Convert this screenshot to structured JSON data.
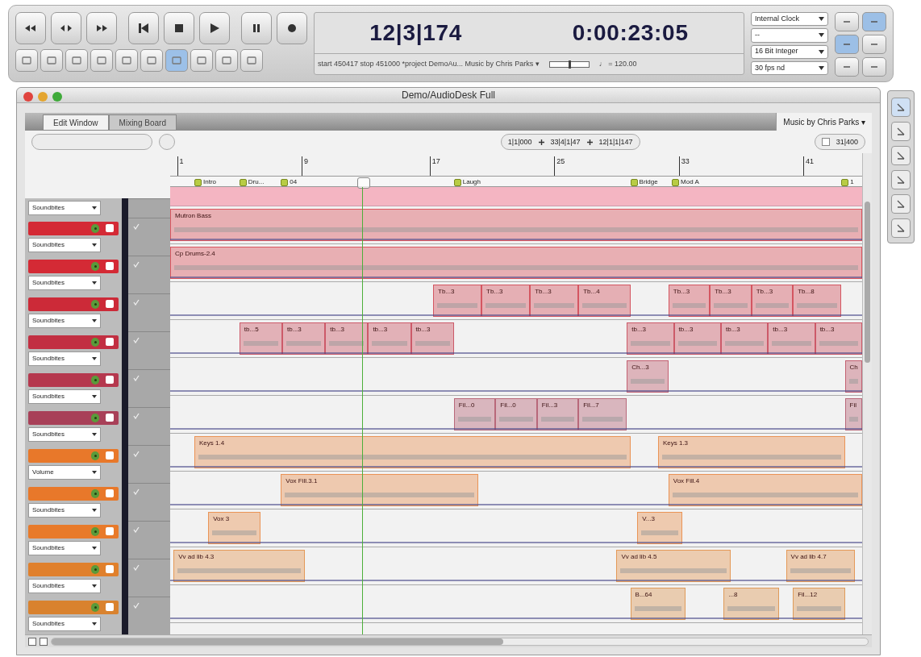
{
  "transport": {
    "counter_bars": "12|3|174",
    "counter_time": "0:00:23:05",
    "info": "start 450417 stop 451000 *project DemoAu... Music by Chris Parks ▾",
    "tempo": "♩ = 120.00",
    "tempo_slider": {
      "level": 0.5
    },
    "dropdowns": [
      "Internal Clock",
      "--",
      "16 Bit Integer",
      "30 fps nd"
    ]
  },
  "window": {
    "title": "Demo/AudioDesk Full"
  },
  "tabs": [
    {
      "label": "Edit Window",
      "selected": true
    },
    {
      "label": "Mixing Board",
      "selected": false
    }
  ],
  "chunk_menu": "Music by Chris Parks ▾",
  "toolbar": {
    "start": "1|1|000",
    "end": "33|4|1|47",
    "duration": "12|1|1|147",
    "zoom": "31|400",
    "checked": false
  },
  "ruler": [
    "1",
    "9",
    "17",
    "25",
    "33",
    "41"
  ],
  "markers": [
    "Intro",
    "Dru...",
    "04",
    "Laugh",
    "Bridge",
    "Mod A",
    "1"
  ],
  "top_automation": "Soundbites",
  "tracks": [
    {
      "color": "#d42a35",
      "automation": "Soundbites",
      "clips": [
        {
          "label": "Mutron Bass"
        }
      ]
    },
    {
      "color": "#d42a35",
      "automation": "Soundbites",
      "clips": [
        {
          "label": "Cp Drums-2.4"
        }
      ]
    },
    {
      "color": "#cc2a38",
      "automation": "Soundbites",
      "clips": [
        {
          "label": "Tb...3"
        },
        {
          "label": "Tb...3"
        },
        {
          "label": "Tb...3"
        },
        {
          "label": "Tb...4"
        },
        {
          "label": "Tb...3"
        },
        {
          "label": "Tb...3"
        },
        {
          "label": "Tb...3"
        },
        {
          "label": "Tb...8"
        }
      ]
    },
    {
      "color": "#c22f42",
      "automation": "Soundbites",
      "clips": [
        {
          "label": "tb...5"
        },
        {
          "label": "tb...3"
        },
        {
          "label": "tb...3"
        },
        {
          "label": "tb...3"
        },
        {
          "label": "tb...3"
        },
        {
          "label": "tb...3"
        },
        {
          "label": "tb...3"
        },
        {
          "label": "tb...3"
        },
        {
          "label": "tb...3"
        },
        {
          "label": "tb...3"
        }
      ]
    },
    {
      "color": "#b5384e",
      "automation": "Soundbites",
      "clips": [
        {
          "label": "Ch...3"
        },
        {
          "label": "Ch"
        }
      ]
    },
    {
      "color": "#a84058",
      "automation": "Soundbites",
      "clips": [
        {
          "label": "Fil...0"
        },
        {
          "label": "Fil...0"
        },
        {
          "label": "Fil...3"
        },
        {
          "label": "Fil...7"
        },
        {
          "label": "Fil"
        }
      ]
    },
    {
      "color": "#e8782a",
      "automation": "Volume",
      "clips": [
        {
          "label": "Keys 1.4"
        },
        {
          "label": "Keys 1.3"
        }
      ]
    },
    {
      "color": "#e8782a",
      "automation": "Soundbites",
      "clips": [
        {
          "label": "Vox Fill.3.1"
        },
        {
          "label": "Vox Fill.4"
        }
      ]
    },
    {
      "color": "#e87a2a",
      "automation": "Soundbites",
      "clips": [
        {
          "label": "Vox 3"
        },
        {
          "label": "V...3"
        }
      ]
    },
    {
      "color": "#e0802c",
      "automation": "Soundbites",
      "clips": [
        {
          "label": "Vv ad lib 4.3"
        },
        {
          "label": "Vv ad lib 4.5"
        },
        {
          "label": "Vv ad lib 4.7"
        }
      ]
    },
    {
      "color": "#d9822e",
      "automation": "Soundbites",
      "clips": [
        {
          "label": "B...64"
        },
        {
          "label": "...8"
        },
        {
          "label": "Fil...12"
        }
      ]
    }
  ]
}
